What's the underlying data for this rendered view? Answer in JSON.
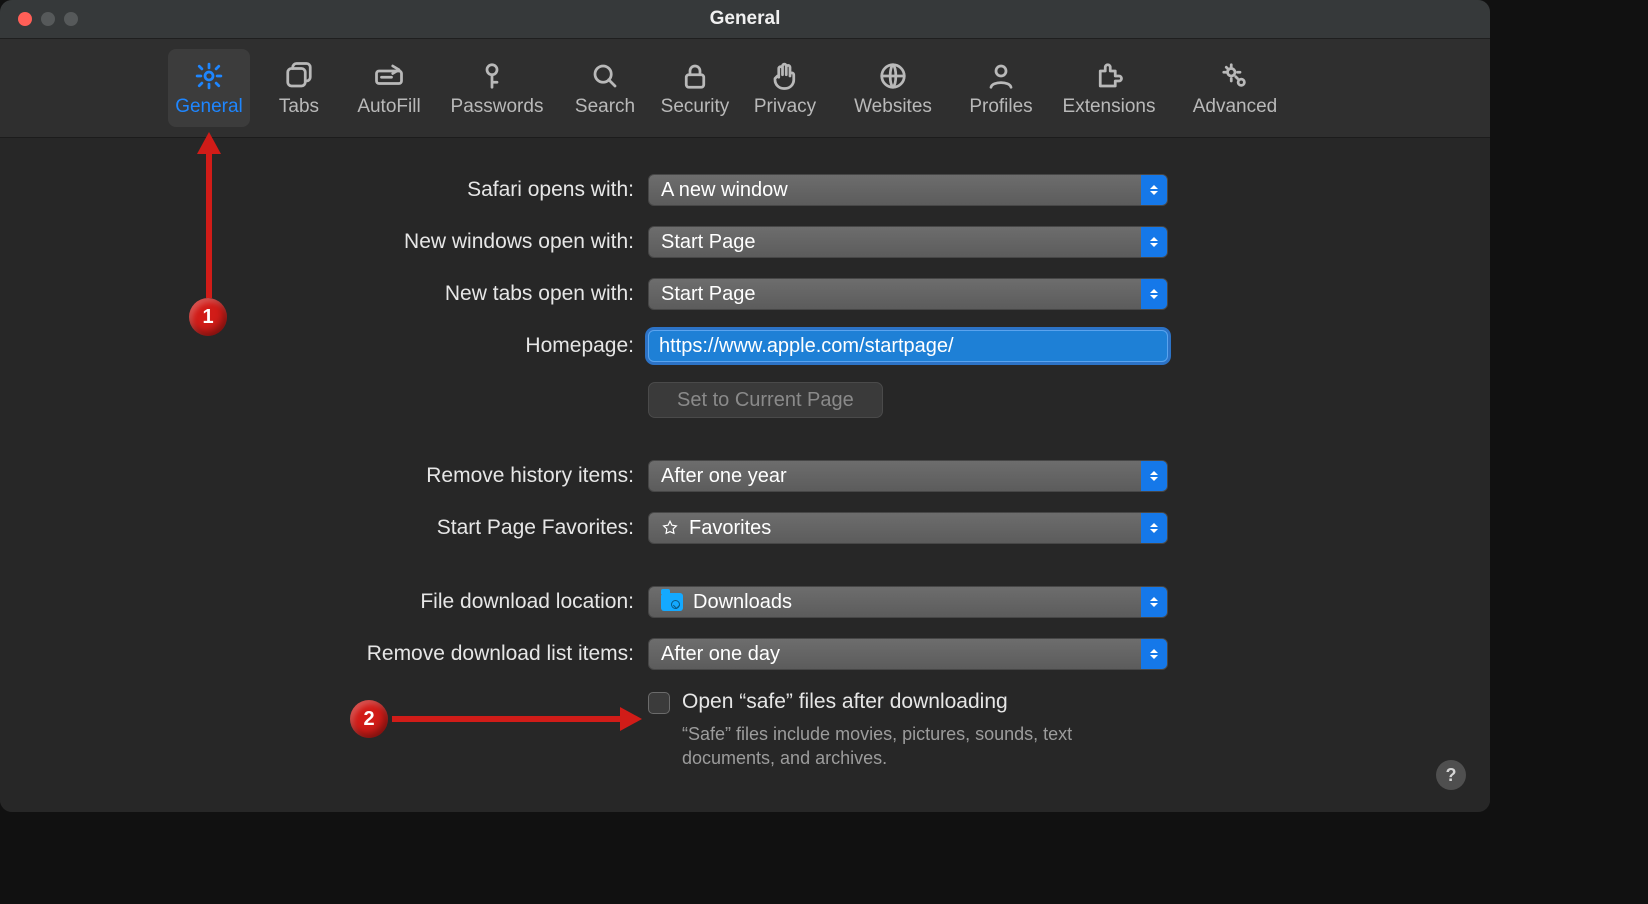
{
  "window": {
    "title": "General"
  },
  "toolbar": {
    "items": [
      {
        "id": "general",
        "label": "General"
      },
      {
        "id": "tabs",
        "label": "Tabs"
      },
      {
        "id": "autofill",
        "label": "AutoFill"
      },
      {
        "id": "passwords",
        "label": "Passwords"
      },
      {
        "id": "search",
        "label": "Search"
      },
      {
        "id": "security",
        "label": "Security"
      },
      {
        "id": "privacy",
        "label": "Privacy"
      },
      {
        "id": "websites",
        "label": "Websites"
      },
      {
        "id": "profiles",
        "label": "Profiles"
      },
      {
        "id": "extensions",
        "label": "Extensions"
      },
      {
        "id": "advanced",
        "label": "Advanced"
      }
    ]
  },
  "form": {
    "safari_opens_label": "Safari opens with:",
    "safari_opens_value": "A new window",
    "new_windows_label": "New windows open with:",
    "new_windows_value": "Start Page",
    "new_tabs_label": "New tabs open with:",
    "new_tabs_value": "Start Page",
    "homepage_label": "Homepage:",
    "homepage_value": "https://www.apple.com/startpage/",
    "set_current_button": "Set to Current Page",
    "remove_history_label": "Remove history items:",
    "remove_history_value": "After one year",
    "favorites_label": "Start Page Favorites:",
    "favorites_value": "Favorites",
    "download_loc_label": "File download location:",
    "download_loc_value": "Downloads",
    "remove_downloads_label": "Remove download list items:",
    "remove_downloads_value": "After one day",
    "safe_files_label": "Open “safe” files after downloading",
    "safe_files_sub": "“Safe” files include movies, pictures, sounds, text documents, and archives."
  },
  "annotations": {
    "badge1": "1",
    "badge2": "2"
  },
  "help_button": "?"
}
